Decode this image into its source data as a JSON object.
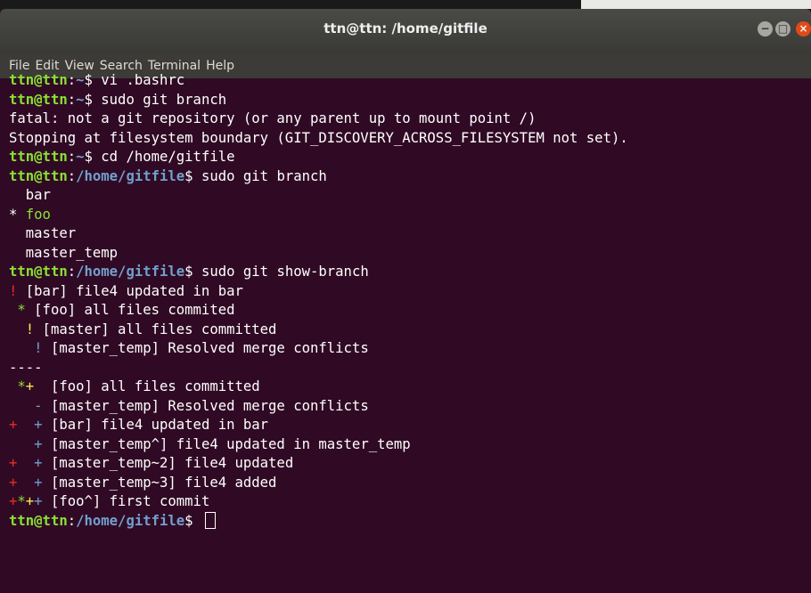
{
  "window": {
    "title": "ttn@ttn: /home/gitfile",
    "buttons": {
      "minimize": "−",
      "maximize": "□",
      "close": "×"
    }
  },
  "menu": [
    "File",
    "Edit",
    "View",
    "Search",
    "Terminal",
    "Help"
  ],
  "prompt": {
    "user_host": "ttn@ttn",
    "colon": ":",
    "dollar": "$ "
  },
  "terminal": {
    "l1": {
      "path": "~",
      "cmd": "vi .bashrc"
    },
    "l2": {
      "path": "~",
      "cmd": "sudo git branch"
    },
    "l3": "fatal: not a git repository (or any parent up to mount point /)",
    "l4": "Stopping at filesystem boundary (GIT_DISCOVERY_ACROSS_FILESYSTEM not set).",
    "l5": {
      "path": "~",
      "cmd": "cd /home/gitfile"
    },
    "l6": {
      "path": "/home/gitfile",
      "cmd": "sudo git branch"
    },
    "l7": "  bar",
    "l8": {
      "mark": "* ",
      "branch": "foo"
    },
    "l9": "  master",
    "l10": "  master_temp",
    "l11": {
      "path": "/home/gitfile",
      "cmd": "sudo git show-branch"
    },
    "l12": {
      "m": "!",
      "text": " [bar] file4 updated in bar"
    },
    "l13": {
      "m": " *",
      "text": " [foo] all files commited"
    },
    "l14": {
      "m": "  !",
      "text": " [master] all files committed"
    },
    "l15": {
      "m": "   !",
      "text": " [master_temp] Resolved merge conflicts"
    },
    "l16": "----",
    "l17": {
      "m1": " *",
      "m2": "+",
      "text": "  [foo] all files committed"
    },
    "l18": {
      "m": "   -",
      "text": " [master_temp] Resolved merge conflicts"
    },
    "l19": {
      "m1": "+",
      "m2": "  +",
      "text": " [bar] file4 updated in bar"
    },
    "l20": {
      "m": "   +",
      "text": " [master_temp^] file4 updated in master_temp"
    },
    "l21": {
      "m1": "+",
      "m2": "  +",
      "text": " [master_temp~2] file4 updated"
    },
    "l22": {
      "m1": "+",
      "m2": "  +",
      "text": " [master_temp~3] file4 added"
    },
    "l23": {
      "m1": "+",
      "m2": "*",
      "m3": "+",
      "m4": "+",
      "text": " [foo^] first commit"
    },
    "l24": {
      "path": "/home/gitfile",
      "cmd": ""
    }
  },
  "colors": {
    "background": "#300a24",
    "prompt_user": "#8ae234",
    "prompt_path": "#729fcf",
    "marker_red": "#ef2929",
    "marker_yellow": "#fce94f",
    "marker_blue": "#729fcf"
  }
}
